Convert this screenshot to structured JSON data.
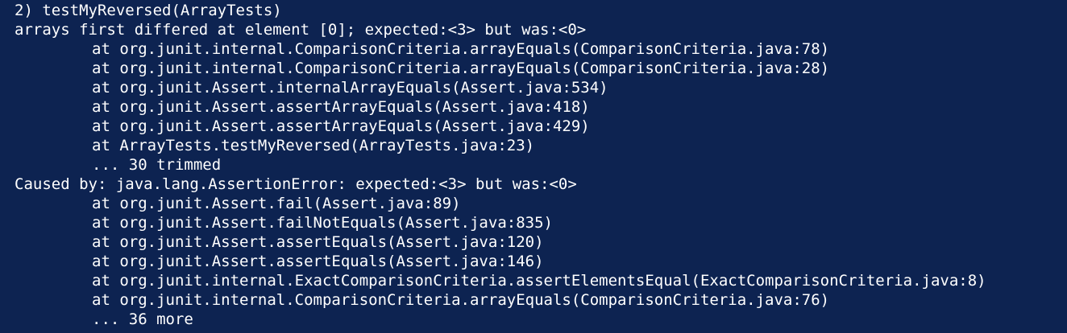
{
  "terminal": {
    "lines": [
      {
        "text": "2) testMyReversed(ArrayTests)",
        "indent": false
      },
      {
        "text": "arrays first differed at element [0]; expected:<3> but was:<0>",
        "indent": false
      },
      {
        "text": "at org.junit.internal.ComparisonCriteria.arrayEquals(ComparisonCriteria.java:78)",
        "indent": true
      },
      {
        "text": "at org.junit.internal.ComparisonCriteria.arrayEquals(ComparisonCriteria.java:28)",
        "indent": true
      },
      {
        "text": "at org.junit.Assert.internalArrayEquals(Assert.java:534)",
        "indent": true
      },
      {
        "text": "at org.junit.Assert.assertArrayEquals(Assert.java:418)",
        "indent": true
      },
      {
        "text": "at org.junit.Assert.assertArrayEquals(Assert.java:429)",
        "indent": true
      },
      {
        "text": "at ArrayTests.testMyReversed(ArrayTests.java:23)",
        "indent": true
      },
      {
        "text": "... 30 trimmed",
        "indent": true
      },
      {
        "text": "Caused by: java.lang.AssertionError: expected:<3> but was:<0>",
        "indent": false
      },
      {
        "text": "at org.junit.Assert.fail(Assert.java:89)",
        "indent": true
      },
      {
        "text": "at org.junit.Assert.failNotEquals(Assert.java:835)",
        "indent": true
      },
      {
        "text": "at org.junit.Assert.assertEquals(Assert.java:120)",
        "indent": true
      },
      {
        "text": "at org.junit.Assert.assertEquals(Assert.java:146)",
        "indent": true
      },
      {
        "text": "at org.junit.internal.ExactComparisonCriteria.assertElementsEqual(ExactComparisonCriteria.java:8)",
        "indent": true
      },
      {
        "text": "at org.junit.internal.ComparisonCriteria.arrayEquals(ComparisonCriteria.java:76)",
        "indent": true
      },
      {
        "text": "... 36 more",
        "indent": true
      }
    ]
  },
  "colors": {
    "background": "#0d2351",
    "text": "#ffffff"
  }
}
